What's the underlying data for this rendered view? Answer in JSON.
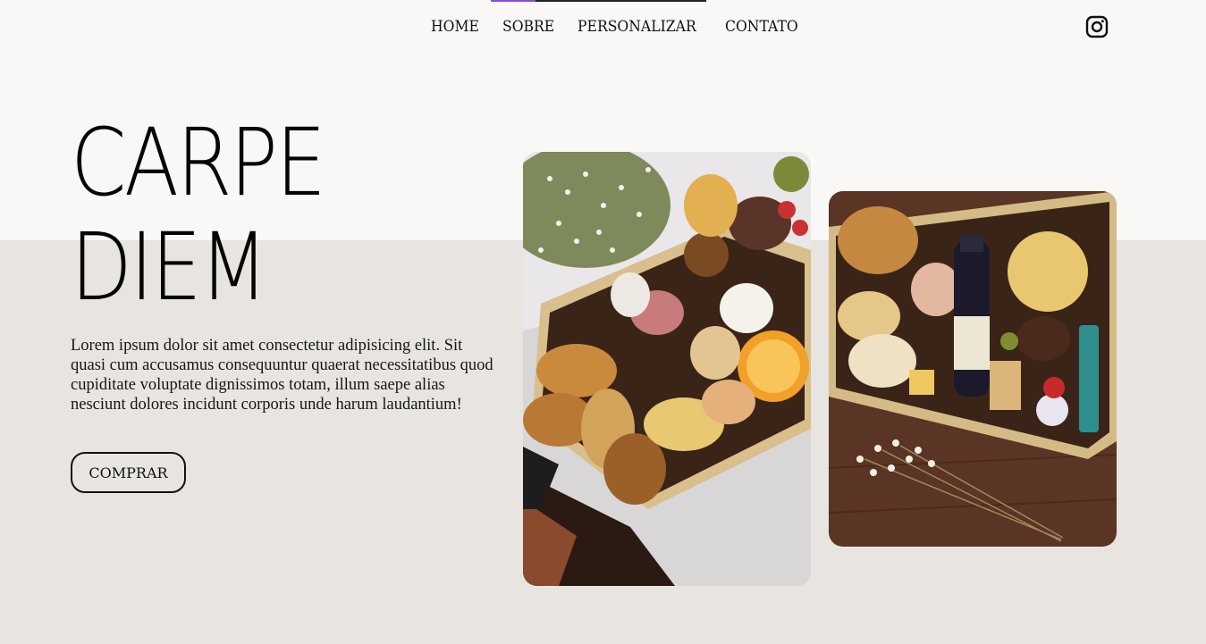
{
  "nav": {
    "items": [
      {
        "label": "HOME"
      },
      {
        "label": "SOBRE"
      },
      {
        "label": "PERSONALIZAR"
      },
      {
        "label": "CONTATO"
      }
    ],
    "social_icon": "instagram-icon"
  },
  "hero": {
    "title_line1": "CARPE",
    "title_line2": "DIEM",
    "description": "Lorem ipsum dolor sit amet consectetur adipisicing elit. Sit quasi cum accusamus consequuntur quaerat necessitatibus quod cupiditate voluptate dignissimos totam, illum saepe alias nesciunt dolores incidunt corporis unde harum laudantium!",
    "button_label": "COMPRAR"
  },
  "colors": {
    "top_background": "#faf8f7",
    "bottom_background": "#e8e5e0",
    "text": "#111111",
    "nav_accent": "#8a4fd1"
  },
  "images": [
    {
      "name": "breakfast-box-photo-1"
    },
    {
      "name": "breakfast-box-photo-2"
    }
  ]
}
